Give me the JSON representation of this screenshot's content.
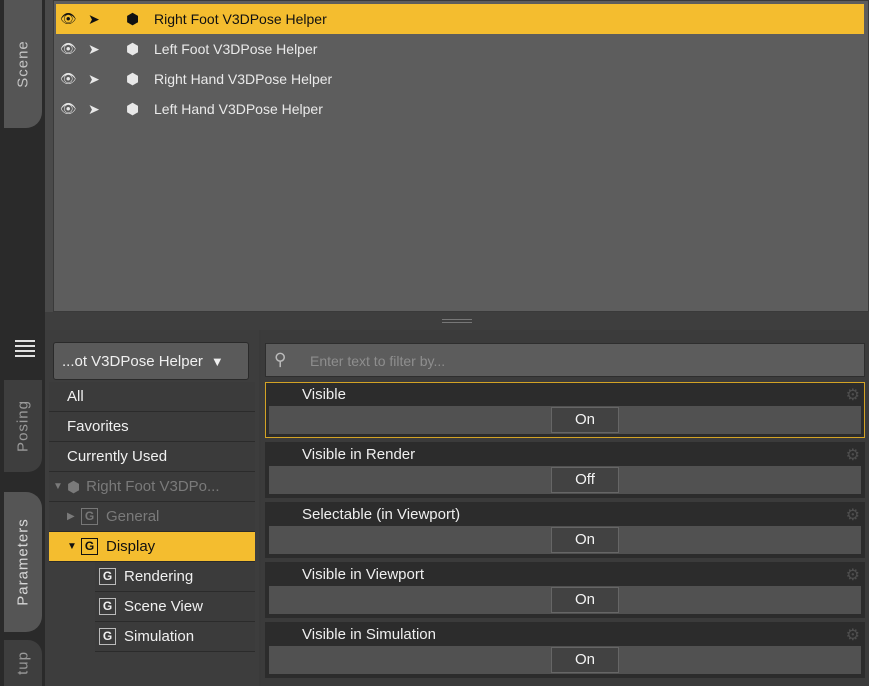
{
  "tabs": {
    "scene": "Scene",
    "posing": "Posing",
    "parameters": "Parameters",
    "setup": "tup"
  },
  "scene": {
    "items": [
      {
        "label": "Right Foot V3DPose Helper",
        "selected": true
      },
      {
        "label": "Left Foot V3DPose Helper",
        "selected": false
      },
      {
        "label": "Right Hand V3DPose Helper",
        "selected": false
      },
      {
        "label": "Left Hand V3DPose Helper",
        "selected": false
      }
    ]
  },
  "parameters": {
    "node_dropdown": "...ot V3DPose Helper",
    "filter_placeholder": "Enter text to filter by...",
    "tree": {
      "all": "All",
      "favorites": "Favorites",
      "currently_used": "Currently Used",
      "node": "Right Foot V3DPo...",
      "general": "General",
      "display": "Display",
      "rendering": "Rendering",
      "scene_view": "Scene View",
      "simulation": "Simulation"
    },
    "properties": [
      {
        "label": "Visible",
        "value": "On"
      },
      {
        "label": "Visible in Render",
        "value": "Off"
      },
      {
        "label": "Selectable (in Viewport)",
        "value": "On"
      },
      {
        "label": "Visible in Viewport",
        "value": "On"
      },
      {
        "label": "Visible in Simulation",
        "value": "On"
      }
    ]
  },
  "colors": {
    "selection": "#f4bd2f",
    "panel": "#5d5d5d",
    "dark": "#2c2c2c"
  }
}
